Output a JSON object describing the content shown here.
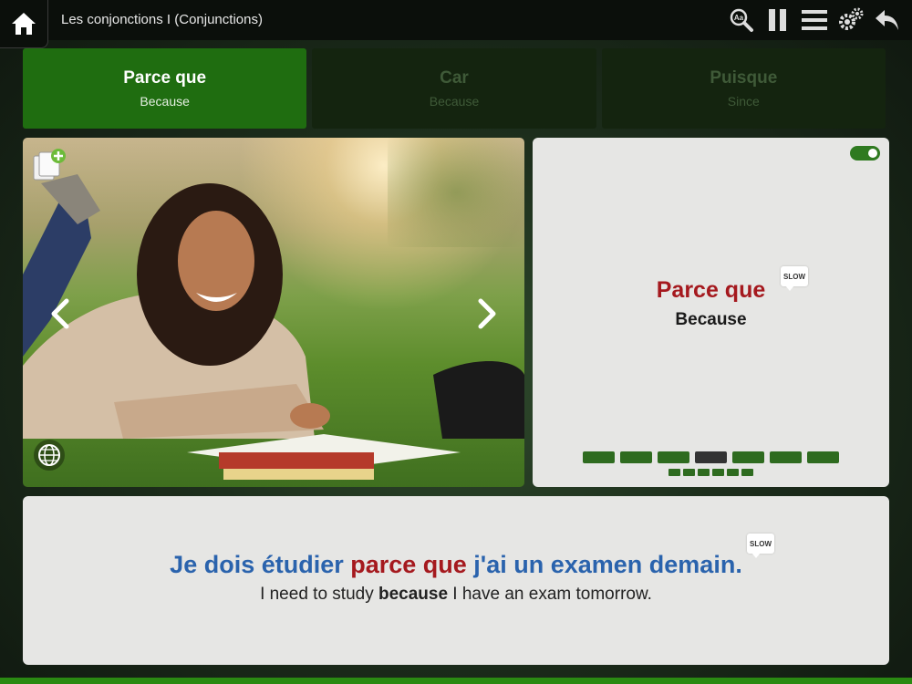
{
  "header": {
    "title": "Les conjonctions I (Conjunctions)",
    "tools": [
      "home-icon",
      "text-size-search-icon",
      "pause-icon",
      "menu-icon",
      "settings-gears-icon",
      "back-arrow-icon"
    ]
  },
  "tabs": [
    {
      "main": "Parce que",
      "sub": "Because",
      "active": true
    },
    {
      "main": "Car",
      "sub": "Because",
      "active": false
    },
    {
      "main": "Puisque",
      "sub": "Since",
      "active": false
    }
  ],
  "word_card": {
    "main": "Parce que",
    "translation": "Because",
    "slow_label": "SLOW",
    "toggle_on": true,
    "progress_total": 7,
    "progress_current": 4,
    "sub_progress_total": 6
  },
  "sentence": {
    "fr_before": "Je dois étudier ",
    "fr_highlight": "parce que",
    "fr_after": " j'ai un examen demain.",
    "en_before": "I need to study ",
    "en_highlight": "because",
    "en_after": " I have an exam tomorrow.",
    "slow_label": "SLOW"
  },
  "colors": {
    "accent_green": "#1f6d10",
    "highlight_red": "#a5191e",
    "french_blue": "#2a63ad"
  }
}
